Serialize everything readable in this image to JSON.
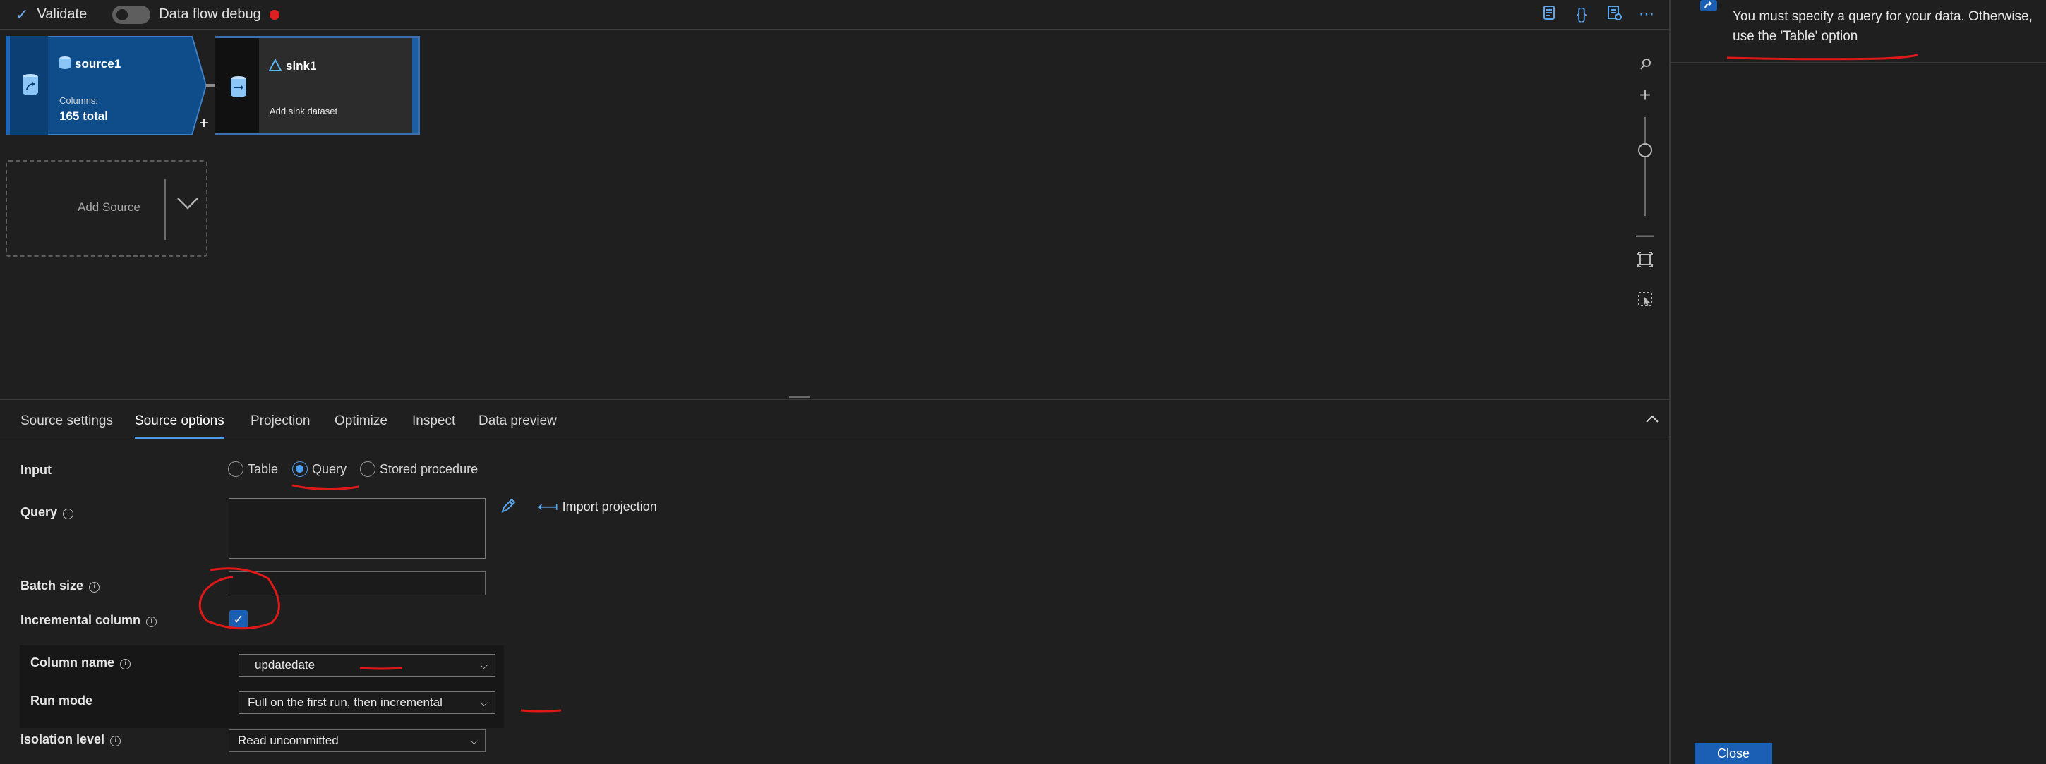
{
  "toolbar": {
    "validate_label": "Validate",
    "debug_label": "Data flow debug",
    "icons": [
      "script-icon",
      "code-icon",
      "properties-icon",
      "more-icon"
    ]
  },
  "nodes": {
    "source": {
      "title": "source1",
      "columns_label": "Columns:",
      "columns_value": "165 total"
    },
    "sink": {
      "title": "sink1",
      "dataset_label": "Add sink dataset"
    },
    "add_source_label": "Add Source"
  },
  "tabs": [
    "Source settings",
    "Source options",
    "Projection",
    "Optimize",
    "Inspect",
    "Data preview"
  ],
  "active_tab": "Source options",
  "form": {
    "input_label": "Input",
    "input_options": [
      "Table",
      "Query",
      "Stored procedure"
    ],
    "input_selected": "Query",
    "query_label": "Query",
    "query_value": "",
    "import_projection_label": "Import projection",
    "batch_size_label": "Batch size",
    "batch_size_value": "",
    "incremental_label": "Incremental column",
    "incremental_checked": true,
    "column_name_label": "Column name",
    "column_name_value": "updatedate",
    "run_mode_label": "Run mode",
    "run_mode_value": "Full on the first run, then incremental",
    "isolation_label": "Isolation level",
    "isolation_value": "Read uncommitted"
  },
  "panel": {
    "message": "You must specify a query for your data. Otherwise, use the 'Table' option",
    "close_label": "Close"
  },
  "colors": {
    "accent": "#4a9ef0",
    "source_node": "#0f4c8a",
    "annotation": "#e01818",
    "debug_dot": "#e02020"
  }
}
